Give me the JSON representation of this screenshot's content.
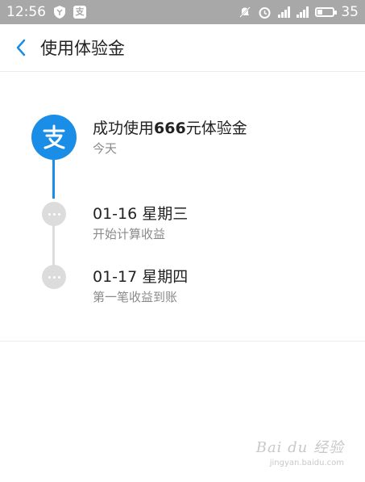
{
  "status_bar": {
    "time": "12:56",
    "battery_level": "35",
    "battery_fraction": 0.35,
    "app_icons": [
      "shield-icon",
      "alipay-small-icon"
    ],
    "system_icons": [
      "mute-icon",
      "alarm-icon",
      "signal-icon",
      "signal-icon",
      "battery-icon"
    ],
    "alipay_char": "支"
  },
  "header": {
    "title": "使用体验金",
    "back_icon": "chevron-left-icon"
  },
  "timeline": {
    "events": [
      {
        "title_prefix": "成功使用",
        "title_amount": "666",
        "title_suffix": "元体验金",
        "subtitle": "今天",
        "icon": "alipay-icon"
      },
      {
        "title": "01-16 星期三",
        "subtitle": "开始计算收益",
        "icon": "ellipsis-icon"
      },
      {
        "title": "01-17 星期四",
        "subtitle": "第一笔收益到账",
        "icon": "ellipsis-icon"
      }
    ]
  },
  "watermark": {
    "line1": "Bai du 经验",
    "line2": "jingyan.baidu.com"
  },
  "colors": {
    "status_bar_bg": "#a8a8a8",
    "accent_blue": "#1a8de6",
    "node_gray": "#dcdcdc",
    "text_primary": "#222222",
    "text_secondary": "#8a8a8a"
  }
}
